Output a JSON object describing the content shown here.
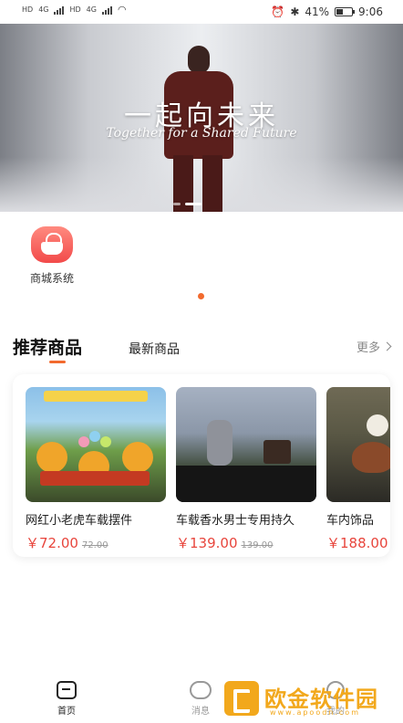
{
  "status_bar": {
    "left_labels": [
      "HD",
      "4G",
      "HD",
      "4G"
    ],
    "battery": "41%",
    "battery_level": 0.41,
    "time": "9:06"
  },
  "banner": {
    "title": "一起向未来",
    "subtitle": "Together for a Shared Future",
    "slide_count": 2,
    "active_slide": 2
  },
  "shortcuts": [
    {
      "label": "商城系统",
      "icon": "shopping-bag-icon"
    }
  ],
  "tabs": {
    "active": "推荐商品",
    "other": "最新商品",
    "more": "更多"
  },
  "products": [
    {
      "name": "网红小老虎车载摆件",
      "price": "￥72.00",
      "original_price": "72.00"
    },
    {
      "name": "车载香水男士专用持久",
      "price": "￥139.00",
      "original_price": "139.00"
    },
    {
      "name": "车内饰品",
      "price": "￥188.00",
      "original_price": ""
    }
  ],
  "bottom_nav": [
    {
      "label": "首页",
      "icon": "home-icon",
      "active": true
    },
    {
      "label": "消息",
      "icon": "message-icon",
      "active": false
    },
    {
      "label": "我的",
      "icon": "user-icon",
      "active": false
    }
  ],
  "watermark": {
    "text": "欧金软件园",
    "url": "www.apoodn.com"
  },
  "colors": {
    "accent": "#f26a2e",
    "price": "#e8453c",
    "watermark": "#f2a81c"
  }
}
